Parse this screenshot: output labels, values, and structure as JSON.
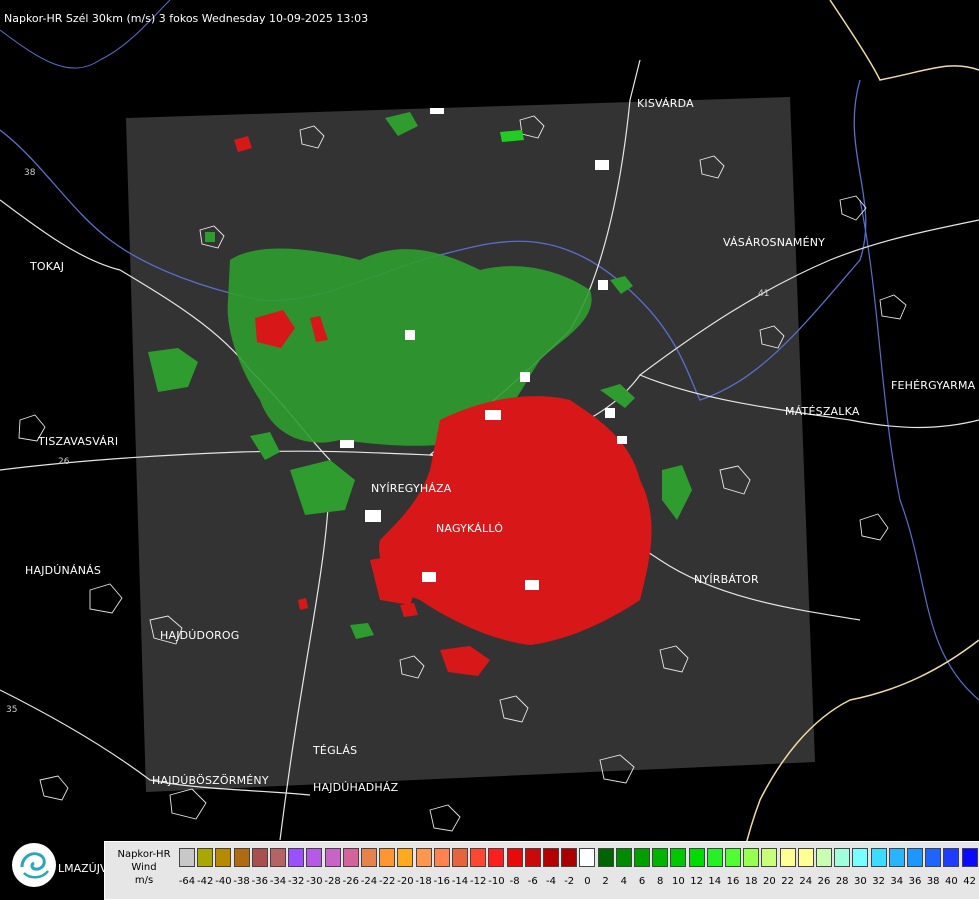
{
  "title": "Napkor-HR Szél 30km (m/s) 3 fokos Wednesday 10-09-2025 13:03",
  "cities": [
    {
      "id": "kisvarda",
      "name": "KISVÁRDA"
    },
    {
      "id": "tokaj",
      "name": "TOKAJ"
    },
    {
      "id": "vasarosnameny",
      "name": "VÁSÁROSNAMÉNY"
    },
    {
      "id": "fehergyarmat",
      "name": "FEHÉRGYARMA"
    },
    {
      "id": "mateszalka",
      "name": "MÁTÉSZALKA"
    },
    {
      "id": "tiszavasvari",
      "name": "TISZAVASVÁRI"
    },
    {
      "id": "nyiregyhaza",
      "name": "NYÍREGYHÁZA"
    },
    {
      "id": "nagykallo",
      "name": "NAGYKÁLLÓ"
    },
    {
      "id": "hajdunanas",
      "name": "HAJDÚNÁNÁS"
    },
    {
      "id": "nyirbator",
      "name": "NYÍRBÁTOR"
    },
    {
      "id": "hajdudorog",
      "name": "HAJDÚDOROG"
    },
    {
      "id": "teglas",
      "name": "TÉGLÁS"
    },
    {
      "id": "hajduboszormeny",
      "name": "HAJDÚBÖSZÖRMÉNY"
    },
    {
      "id": "hajduhadhaz",
      "name": "HAJDÚHADHÁZ"
    }
  ],
  "road_numbers": [
    "38",
    "26",
    "41",
    "35"
  ],
  "logo_text": "LMAZÚJVÁR",
  "legend": {
    "title_line1": "Napkor-HR",
    "title_line2": "Wind",
    "unit": "m/s",
    "ticks": [
      "-64",
      "-42",
      "-40",
      "-38",
      "-36",
      "-34",
      "-32",
      "-30",
      "-28",
      "-26",
      "-24",
      "-22",
      "-20",
      "-18",
      "-16",
      "-14",
      "-12",
      "-10",
      "-8",
      "-6",
      "-4",
      "-2",
      "0",
      "2",
      "4",
      "6",
      "8",
      "10",
      "12",
      "14",
      "16",
      "18",
      "20",
      "22",
      "24",
      "26",
      "28",
      "30",
      "32",
      "34",
      "36",
      "38",
      "40",
      "42"
    ],
    "colors": [
      "#c8c8c8",
      "#a8a800",
      "#b88a00",
      "#b06a10",
      "#a85050",
      "#b46464",
      "#9b50ff",
      "#b45ae6",
      "#c864c8",
      "#d2649b",
      "#e6824b",
      "#ff9632",
      "#ffaa1e",
      "#ff9650",
      "#ff8250",
      "#e6643c",
      "#ff4632",
      "#ff1e1e",
      "#e60a0a",
      "#c80a0a",
      "#b40000",
      "#aa0000",
      "#ffffff",
      "#006400",
      "#008c00",
      "#00a000",
      "#00b400",
      "#00c800",
      "#00dc00",
      "#28f028",
      "#50ff32",
      "#96ff50",
      "#c8ff78",
      "#ffff96",
      "#ffff96",
      "#c8ffb4",
      "#a0ffdc",
      "#78ffff",
      "#3cdcff",
      "#28b4ff",
      "#1e96ff",
      "#1e64ff",
      "#1e3cff",
      "#0a0aff"
    ]
  },
  "colors": {
    "background": "#000000",
    "radar_area": "#333333",
    "border_line": "#ffffff",
    "river": "#5a6ec8",
    "country_border": "#f0dca0",
    "green_echo": "#2e9c2e",
    "red_echo": "#d81818"
  }
}
